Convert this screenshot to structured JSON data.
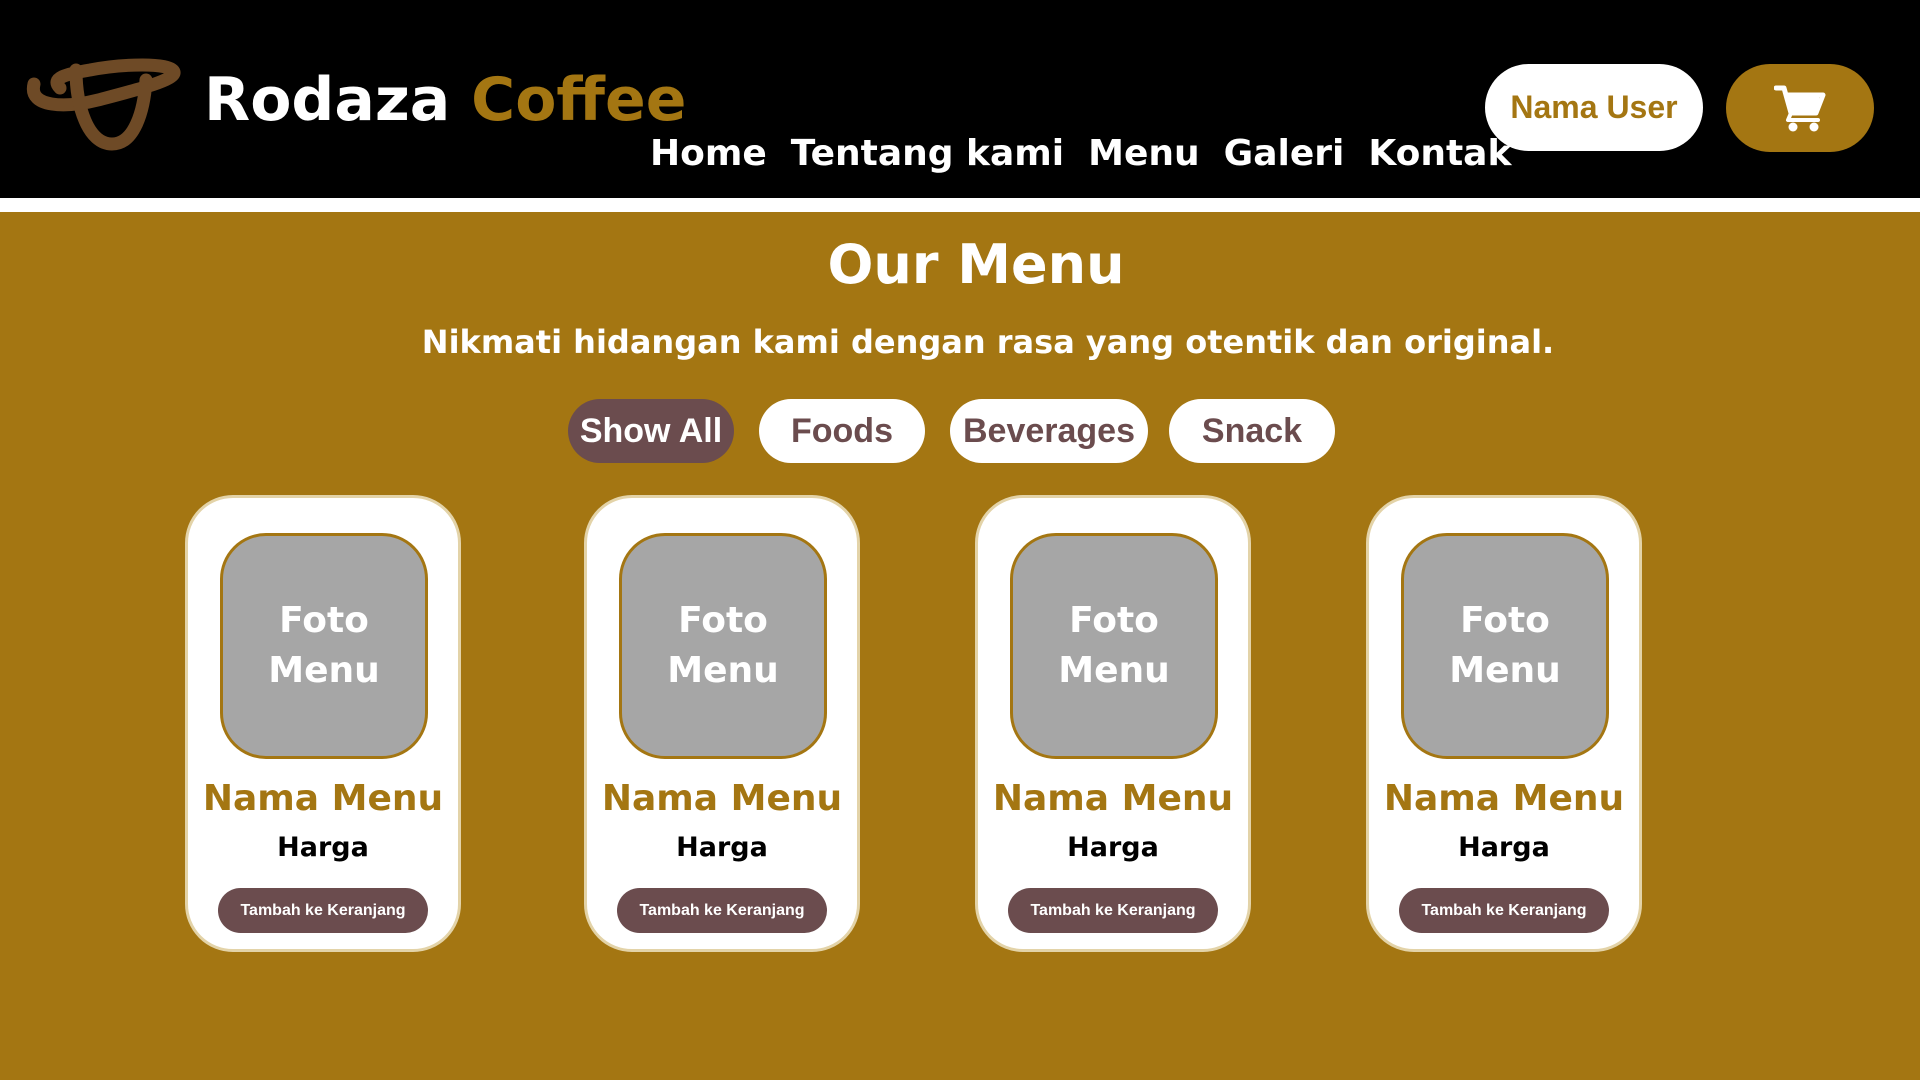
{
  "header": {
    "brand_first": "Rodaza",
    "brand_second": "Coffee",
    "nav": [
      "Home",
      "Tentang kami",
      "Menu",
      "Galeri",
      "Kontak"
    ],
    "user_label": "Nama User",
    "cart_icon": "cart-icon",
    "logo_icon": "coffee-logo-icon"
  },
  "main": {
    "title": "Our Menu",
    "subtitle": "Nikmati hidangan kami dengan rasa yang otentik dan original.",
    "filters": [
      {
        "label": "Show All",
        "active": true
      },
      {
        "label": "Foods",
        "active": false
      },
      {
        "label": "Beverages",
        "active": false
      },
      {
        "label": "Snack",
        "active": false
      }
    ],
    "cards": [
      {
        "photo_line1": "Foto",
        "photo_line2": "Menu",
        "name": "Nama Menu",
        "price": "Harga",
        "button": "Tambah ke Keranjang"
      },
      {
        "photo_line1": "Foto",
        "photo_line2": "Menu",
        "name": "Nama Menu",
        "price": "Harga",
        "button": "Tambah ke Keranjang"
      },
      {
        "photo_line1": "Foto",
        "photo_line2": "Menu",
        "name": "Nama Menu",
        "price": "Harga",
        "button": "Tambah ke Keranjang"
      },
      {
        "photo_line1": "Foto",
        "photo_line2": "Menu",
        "name": "Nama Menu",
        "price": "Harga",
        "button": "Tambah ke Keranjang"
      }
    ]
  },
  "colors": {
    "background": "#a47612",
    "header": "#000000",
    "accent": "#a47612",
    "button": "#6b4c4e",
    "logo": "#6e4a26",
    "photo_placeholder": "#a6a6a6"
  }
}
